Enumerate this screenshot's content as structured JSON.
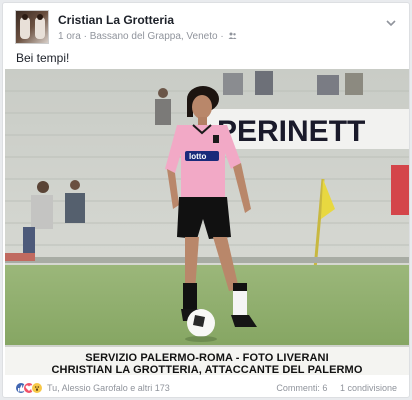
{
  "post": {
    "author": "Cristian La Grotteria",
    "time": "1 ora",
    "location": "Bassano del Grappa, Veneto",
    "separator": "·",
    "text": "Bei tempi!",
    "audience_icon": "friends-icon",
    "menu_icon": "chevron-down-icon"
  },
  "photo": {
    "banner_text": "PERINETT",
    "jersey_brand": "lotto",
    "caption_line1": "SERVIZIO PALERMO-ROMA - FOTO LIVERANI",
    "caption_line2": "CHRISTIAN LA GROTTERIA, ATTACCANTE DEL PALERMO",
    "colors": {
      "jersey": "#f2a9c6",
      "shorts": "#111111",
      "grass": "#8fae6c"
    }
  },
  "footer": {
    "reactions": [
      "like-icon",
      "love-icon",
      "wow-icon"
    ],
    "likes_text": "Tu, Alessio Garofalo e altri 173",
    "comments": "Commenti: 6",
    "shares": "1 condivisione"
  }
}
